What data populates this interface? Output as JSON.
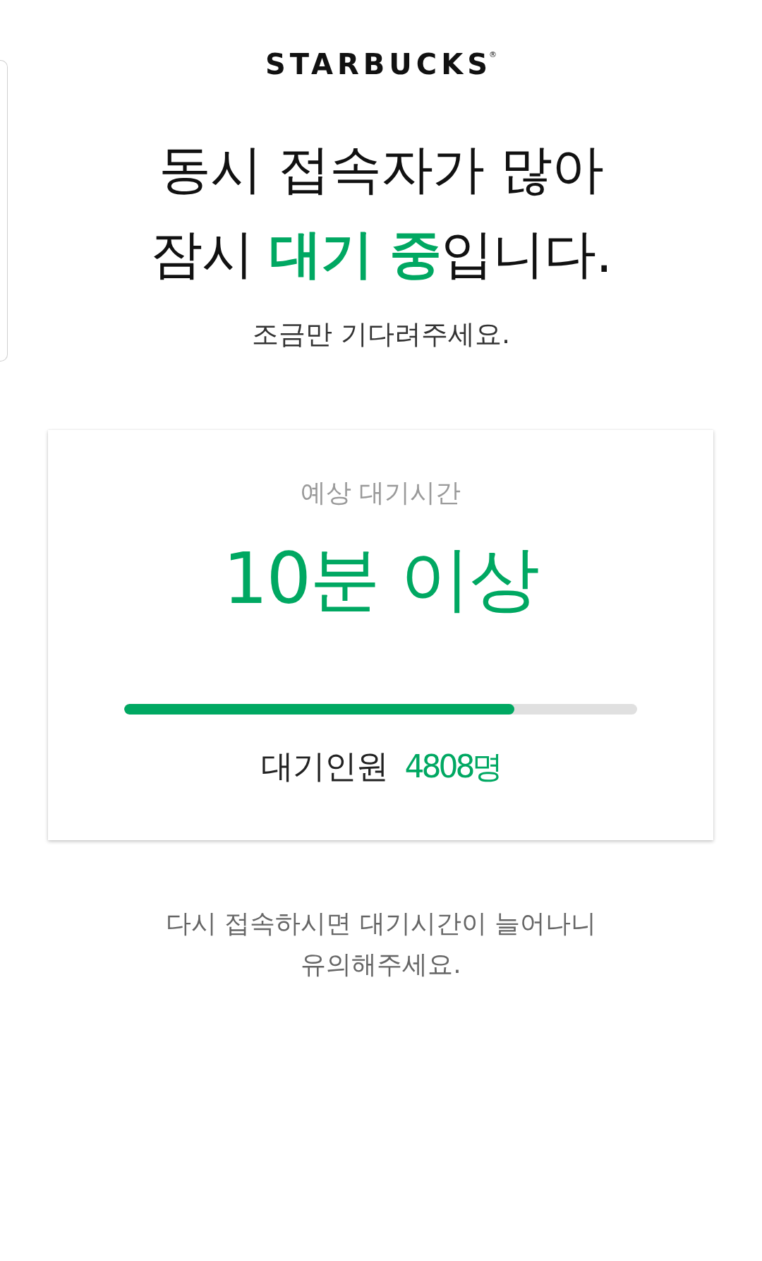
{
  "logo": {
    "text": "STARBUCKS$^{®}$"
  },
  "headline": {
    "lines": [
      "동시 접속자가 많아",
      "잠시 **대기 중**입니다."
    ]
  },
  "subtitle": "조금만 기다려주세요.",
  "wait_card": {
    "label": "예상 대기시간",
    "estimate": "10분 이상",
    "progress": {
      "level": 0.76
    },
    "queue_label": "대기인원",
    "queue_count": "4808명"
  },
  "notice": {
    "lines": [
      "다시 접속하시면 대기시간이 늘어나니",
      "유의해주세요."
    ]
  }
}
